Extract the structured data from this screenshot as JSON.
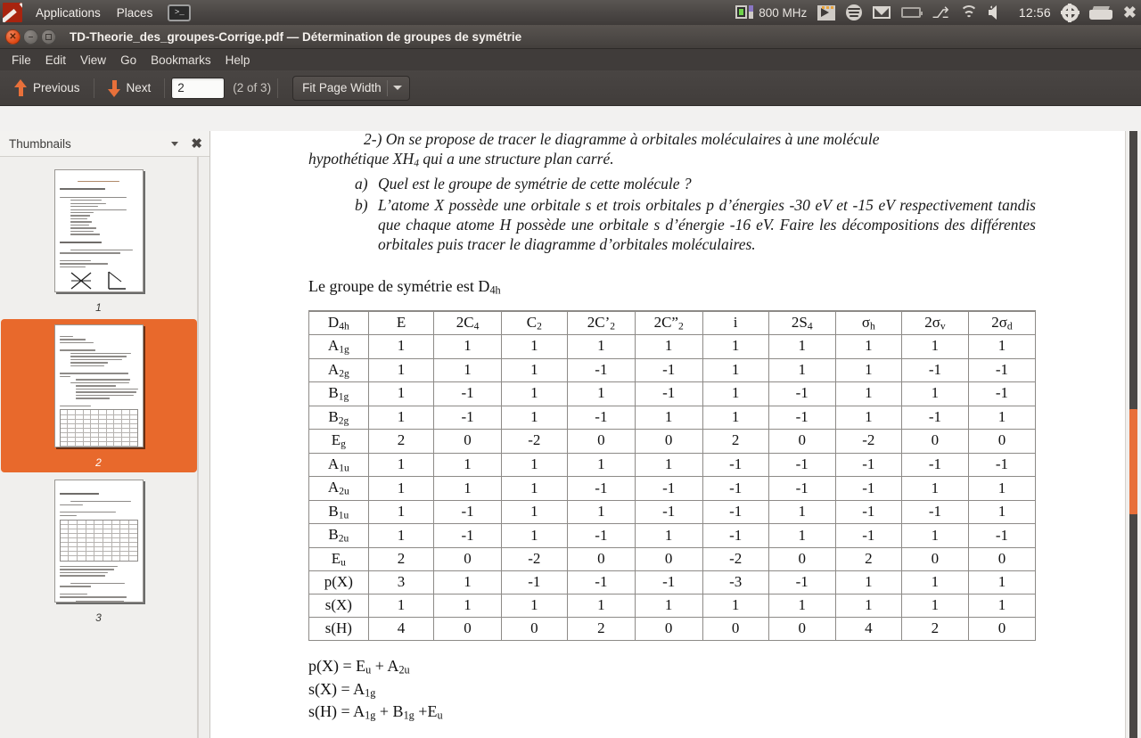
{
  "top_panel": {
    "logo_icon": "ubuntu-logo-icon",
    "menus": [
      "Applications",
      "Places"
    ],
    "terminal_icon": "terminal-icon",
    "terminal_glyph": ">_",
    "cpu_freq": "800 MHz",
    "tray_icons": [
      "video-icon",
      "spotify-icon",
      "mail-icon",
      "battery-icon",
      "bluetooth-icon",
      "wifi-icon",
      "volume-icon"
    ],
    "clock": "12:56",
    "settings_icon": "gear-icon",
    "keyboard_icon": "keyboard-icon",
    "close_icon": "close-icon"
  },
  "window": {
    "title": "TD-Theorie_des_groupes-Corrige.pdf — Détermination de groupes de symétrie",
    "buttons": {
      "close": "close-button",
      "minimize": "minimize-button",
      "maximize": "maximize-button"
    },
    "menubar": [
      "File",
      "Edit",
      "View",
      "Go",
      "Bookmarks",
      "Help"
    ]
  },
  "toolbar": {
    "previous_label": "Previous",
    "next_label": "Next",
    "page_value": "2",
    "page_placeholder": "",
    "page_of": "(2 of 3)",
    "zoom_label": "Fit Page Width",
    "prev_icon": "arrow-up-icon",
    "next_icon": "arrow-down-icon",
    "zoom_caret_icon": "chevron-down-icon"
  },
  "sidebar": {
    "title": "Thumbnails",
    "caret_icon": "chevron-down-icon",
    "close_icon": "close-icon",
    "thumbnails": [
      {
        "label": "1",
        "selected": false
      },
      {
        "label": "2",
        "selected": true
      },
      {
        "label": "3",
        "selected": false
      }
    ]
  },
  "document": {
    "para_intro": "2-) On se propose de tracer le diagramme à orbitales moléculaires à une molécule hypothétique XH4 qui a une structure plan carré.",
    "para_intro_line1": "2-) On se propose de tracer le diagramme à orbitales moléculaires à une molécule",
    "para_intro_line2": "hypothétique XH",
    "para_intro_line2_sub": "4",
    "para_intro_line2_rest": " qui a une structure plan carré.",
    "item_a_marker": "a)",
    "item_a_text": "Quel est le groupe de symétrie de cette molécule ?",
    "item_b_marker": "b)",
    "item_b_text": "L’atome X possède une orbitale s et trois orbitales p d’énergies -30 eV et -15 eV respectivement tandis que chaque atome H possède une orbitale s d’énergie -16 eV. Faire les décompositions des différentes orbitales puis tracer le diagramme d’orbitales moléculaires.",
    "group_sentence_prefix": "Le groupe de symétrie est D",
    "group_sentence_sub": "4h",
    "equations": [
      {
        "lhs": "p(X) = E",
        "sub1": "u",
        "mid": " + A",
        "sub2": "2u",
        "tail": ""
      },
      {
        "lhs": "s(X) = A",
        "sub1": "1g",
        "mid": "",
        "sub2": "",
        "tail": ""
      },
      {
        "lhs": "s(H) = A",
        "sub1": "1g",
        "mid": " + B",
        "sub2": "1g",
        "tail": " +E",
        "sub3": "u"
      }
    ]
  },
  "chart_data": {
    "type": "table",
    "title": "D4h character table",
    "columns": [
      {
        "main": "D",
        "sub": "4h"
      },
      {
        "main": "E",
        "sub": ""
      },
      {
        "main": "2C",
        "sub": "4"
      },
      {
        "main": "C",
        "sub": "2"
      },
      {
        "main": "2C’",
        "sub": "2"
      },
      {
        "main": "2C”",
        "sub": "2"
      },
      {
        "main": "i",
        "sub": ""
      },
      {
        "main": "2S",
        "sub": "4"
      },
      {
        "main": "σ",
        "sub": "h"
      },
      {
        "main": "2σ",
        "sub": "v"
      },
      {
        "main": "2σ",
        "sub": "d"
      }
    ],
    "rows": [
      {
        "label_main": "A",
        "label_sub": "1g",
        "values": [
          "1",
          "1",
          "1",
          "1",
          "1",
          "1",
          "1",
          "1",
          "1",
          "1"
        ]
      },
      {
        "label_main": "A",
        "label_sub": "2g",
        "values": [
          "1",
          "1",
          "1",
          "-1",
          "-1",
          "1",
          "1",
          "1",
          "-1",
          "-1"
        ]
      },
      {
        "label_main": "B",
        "label_sub": "1g",
        "values": [
          "1",
          "-1",
          "1",
          "1",
          "-1",
          "1",
          "-1",
          "1",
          "1",
          "-1"
        ]
      },
      {
        "label_main": "B",
        "label_sub": "2g",
        "values": [
          "1",
          "-1",
          "1",
          "-1",
          "1",
          "1",
          "-1",
          "1",
          "-1",
          "1"
        ]
      },
      {
        "label_main": "E",
        "label_sub": "g",
        "values": [
          "2",
          "0",
          "-2",
          "0",
          "0",
          "2",
          "0",
          "-2",
          "0",
          "0"
        ]
      },
      {
        "label_main": "A",
        "label_sub": "1u",
        "values": [
          "1",
          "1",
          "1",
          "1",
          "1",
          "-1",
          "-1",
          "-1",
          "-1",
          "-1"
        ]
      },
      {
        "label_main": "A",
        "label_sub": "2u",
        "values": [
          "1",
          "1",
          "1",
          "-1",
          "-1",
          "-1",
          "-1",
          "-1",
          "1",
          "1"
        ]
      },
      {
        "label_main": "B",
        "label_sub": "1u",
        "values": [
          "1",
          "-1",
          "1",
          "1",
          "-1",
          "-1",
          "1",
          "-1",
          "-1",
          "1"
        ]
      },
      {
        "label_main": "B",
        "label_sub": "2u",
        "values": [
          "1",
          "-1",
          "1",
          "-1",
          "1",
          "-1",
          "1",
          "-1",
          "1",
          "-1"
        ]
      },
      {
        "label_main": "E",
        "label_sub": "u",
        "values": [
          "2",
          "0",
          "-2",
          "0",
          "0",
          "-2",
          "0",
          "2",
          "0",
          "0"
        ]
      },
      {
        "label_main": "p(X)",
        "label_sub": "",
        "values": [
          "3",
          "1",
          "-1",
          "-1",
          "-1",
          "-3",
          "-1",
          "1",
          "1",
          "1"
        ]
      },
      {
        "label_main": "s(X)",
        "label_sub": "",
        "values": [
          "1",
          "1",
          "1",
          "1",
          "1",
          "1",
          "1",
          "1",
          "1",
          "1"
        ]
      },
      {
        "label_main": "s(H)",
        "label_sub": "",
        "values": [
          "4",
          "0",
          "0",
          "2",
          "0",
          "0",
          "0",
          "4",
          "2",
          "0"
        ]
      }
    ]
  },
  "colors": {
    "accent_orange": "#e8703a",
    "selection_orange": "#e8692c",
    "panel_dark": "#433f3c",
    "sidebar_bg": "#f0efed"
  }
}
